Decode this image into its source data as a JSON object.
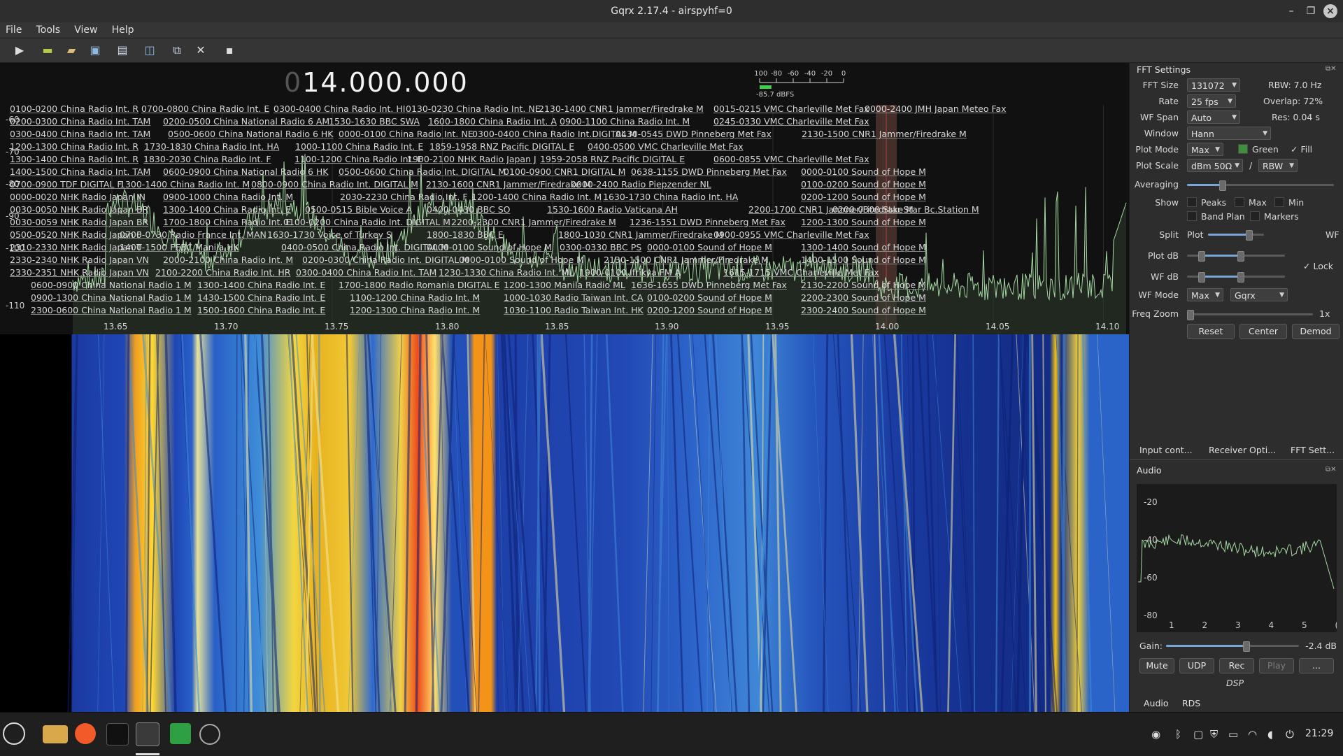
{
  "window": {
    "title": "Gqrx 2.17.4 - airspyhf=0"
  },
  "menu": [
    "File",
    "Tools",
    "View",
    "Help"
  ],
  "toolbar": [
    "play-icon",
    "hardware-icon",
    "open-icon",
    "save-icon",
    "bookmark-icon",
    "plot-icon",
    "remote-icon",
    "settings-icon",
    "dock-icon"
  ],
  "frequency": {
    "leading": "0",
    "value": "14.000.000"
  },
  "meter": {
    "ticks": [
      "-100",
      "-80",
      "-60",
      "-40",
      "-20",
      "0"
    ],
    "reading": "-85.7 dBFS",
    "level_fraction": 0.14
  },
  "db_axis": [
    "-60",
    "-70",
    "-80",
    "-90",
    "-100",
    "-110"
  ],
  "freq_axis": [
    "13.65",
    "13.70",
    "13.75",
    "13.80",
    "13.85",
    "13.90",
    "13.95",
    "14.00",
    "14.05",
    "14.10"
  ],
  "bookmarks": [
    [
      "0100-0200 China Radio Int.  R",
      "0700-0800 China Radio Int.  E",
      "0300-0400 China Radio Int.  HI",
      "0130-0230 China Radio Int.  NE",
      "2130-1400 CNR1 Jammer/Firedrake  M",
      "0015-0215 VMC Charleville Met Fax",
      "0000-2400 JMH Japan Meteo Fax"
    ],
    [
      "0200-0300 China Radio Int.  TAM",
      "0200-0500 China National Radio 6  AM",
      "1530-1630 BBC  SWA",
      "1600-1800 China Radio Int.  A",
      "0900-1100 China Radio Int.  M",
      "0245-0330 VMC Charleville Met Fax"
    ],
    [
      "0300-0400 China Radio Int.  TAM",
      "0500-0600 China National Radio 6  HK",
      "0000-0100 China Radio Int.  NE",
      "0300-0400 China Radio Int.DIGITAL  M",
      "0430-0545 DWD Pinneberg Met Fax",
      "2130-1500 CNR1 Jammer/Firedrake  M"
    ],
    [
      "1200-1300 China Radio Int.  R",
      "1730-1830 China Radio Int.  HA",
      "1000-1100 China Radio Int.  E",
      "1859-1958 RNZ Pacific DIGITAL  E",
      "0400-0500 VMC Charleville Met Fax"
    ],
    [
      "1300-1400 China Radio Int.  R",
      "1830-2030 China Radio Int.  F",
      "1100-1200 China Radio Int.  E",
      "1900-2100 NHK Radio Japan  J",
      "1959-2058 RNZ Pacific DIGITAL  E",
      "0600-0855 VMC Charleville Met Fax"
    ],
    [
      "1400-1500 China Radio Int.  TAM",
      "0600-0900 China National Radio 6  HK",
      "0500-0600 China Radio Int. DIGITAL  M",
      "0100-0900 CNR1 DIGITAL  M",
      "0638-1155 DWD Pinneberg Met Fax",
      "0000-0100 Sound of Hope  M"
    ],
    [
      "0700-0900 TDF DIGITAL  F",
      "1300-1400 China Radio Int.  M",
      "0800-0900 China Radio Int. DIGITAL  M",
      "2130-1600 CNR1 Jammer/Firedrake  M",
      "0000-2400 Radio Piepzender  NL",
      "0100-0200 Sound of Hope  M"
    ],
    [
      "0000-0020 NHK Radio Japan  IN",
      "0900-1000 China Radio Int.  M",
      "2030-2230 China Radio Int.  F",
      "1200-1400 China Radio Int.  M",
      "1630-1730 China Radio Int.  HA",
      "0200-1200 Sound of Hope  M"
    ],
    [
      "0030-0050 NHK Radio Japan  BR",
      "1300-1400 China Radio Int.  E",
      "0500-0515 Bible Voice  A",
      "0400-0430 BBC  SO",
      "1530-1600 Radio Vaticana  AH",
      "2200-1700 CNR1 Jammer/Firedrake  M",
      "0200-0300 Star-Star Bc.Station  M"
    ],
    [
      "0030-0059 NHK Radio Japan  BR",
      "1700-1800 China Radio Int.  E",
      "0100-0200 China Radio Int. DIGITAL  M",
      "2200-2300 CNR1 Jammer/Firedrake  M",
      "1236-1551 DWD Pinneberg Met Fax",
      "1200-1300 Sound of Hope  M"
    ],
    [
      "0500-0520 NHK Radio Japan  F",
      "0700-0730 Radio France Int.  MAN",
      "1630-1730 Voice of Turkey  S",
      "1800-1830 BBC  E",
      "1800-1030 CNR1 Jammer/Firedrake  M",
      "0900-0955 VMC Charleville Met Fax"
    ],
    [
      "2310-2330 NHK Radio Japan  T",
      "1400-1500 FEBC Manila  HK",
      "0400-0500 China Radio Int. DIGITAL  M",
      "0000-0100 Sound of Hope  M",
      "0300-0330 BBC  PS",
      "0000-0100 Sound of Hope  M",
      "1300-1400 Sound of Hope  M"
    ],
    [
      "2330-2340 NHK Radio Japan  VN",
      "2000-2100 China Radio Int.  M",
      "0200-0300 China Radio Int. DIGITAL  M",
      "0000-0100 Sound of Hope  M",
      "2130-1500 CNR1 Jammer/Firedrake  M",
      "1400-1500 Sound of Hope  M"
    ],
    [
      "2330-2351 NHK Radio Japan  VN",
      "2100-2200 China Radio Int.  HR",
      "0300-0400 China Radio Int.  TAM",
      "1230-1330 China Radio Int.  ML",
      "1900-0100 Ifrikya FM  A",
      "1615-1715 VMC Charleville Met Fax"
    ],
    [
      "0600-0900 China National Radio 1  M",
      "1300-1400 China Radio Int.  E",
      "1700-1800 Radio Romania DIGITAL  E",
      "1200-1300 Manila Radio  ML",
      "1636-1655 DWD Pinneberg Met Fax",
      "2130-2200 Sound of Hope  M"
    ],
    [
      "0900-1300 China National Radio 1  M",
      "1430-1500 China Radio Int.  E",
      "1100-1200 China Radio Int.  M",
      "1000-1030 Radio Taiwan Int.  CA",
      "0100-0200 Sound of Hope  M",
      "2200-2300 Sound of Hope  M"
    ],
    [
      "2300-0600 China National Radio 1  M",
      "1500-1600 China Radio Int.  E",
      "1200-1300 China Radio Int.  M",
      "1030-1100 Radio Taiwan Int.  HK",
      "0200-1200 Sound of Hope  M",
      "2300-2400 Sound of Hope  M"
    ]
  ],
  "fft": {
    "title": "FFT Settings",
    "fft_size_label": "FFT Size",
    "fft_size": "131072",
    "rbw": "RBW: 7.0 Hz",
    "rate_label": "Rate",
    "rate": "25 fps",
    "overlap": "Overlap: 72%",
    "wf_span_label": "WF Span",
    "wf_span": "Auto",
    "res": "Res: 0.04 s",
    "window_label": "Window",
    "window": "Hann",
    "plot_mode_label": "Plot Mode",
    "plot_mode": "Max",
    "green": "Green",
    "fill": "Fill",
    "plot_scale_label": "Plot Scale",
    "plot_scale": "dBm 50Ω",
    "slash": "/",
    "rbw_sel": "RBW",
    "averaging_label": "Averaging",
    "show_label": "Show",
    "peaks": "Peaks",
    "max": "Max",
    "min": "Min",
    "band_plan": "Band Plan",
    "markers": "Markers",
    "split_label": "Split",
    "split_plot": "Plot",
    "split_wf": "WF",
    "plot_db_label": "Plot dB",
    "lock": "Lock",
    "wf_db_label": "WF dB",
    "wf_mode_label": "WF Mode",
    "wf_mode": "Max",
    "wf_palette": "Gqrx",
    "freq_zoom_label": "Freq Zoom",
    "freq_zoom": "1x",
    "reset": "Reset",
    "center": "Center",
    "demod": "Demod"
  },
  "dock_tabs": [
    "Input cont...",
    "Receiver Opti...",
    "FFT Sett..."
  ],
  "audio": {
    "title": "Audio",
    "y_ticks": [
      "-20",
      "-40",
      "-60",
      "-80"
    ],
    "x_ticks": [
      "1",
      "2",
      "3",
      "4",
      "5",
      "("
    ],
    "gain_label": "Gain:",
    "gain_value": "-2.4 dB",
    "gain_fraction": 0.6,
    "mute": "Mute",
    "udp": "UDP",
    "rec": "Rec",
    "play": "Play",
    "more": "...",
    "dsp": "DSP"
  },
  "bottom_tabs": [
    "Audio",
    "RDS"
  ],
  "taskbar": {
    "clock": "21:29"
  },
  "colors": {
    "spectrum": "#a7d9a4",
    "waterfall_low": "#0a1f7a",
    "waterfall_high": "#ffd21f",
    "accent": "#78a6d9"
  }
}
